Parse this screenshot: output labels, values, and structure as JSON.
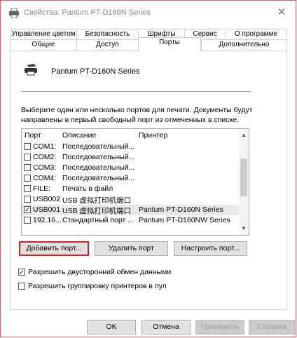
{
  "window": {
    "title": "Свойства: Pantum PT-D160N Series",
    "close_glyph": "✕"
  },
  "tabs_row1": [
    "Управление цветом",
    "Безопасность",
    "Шрифты",
    "Сервис",
    "О программе"
  ],
  "tabs_row2": [
    "Общие",
    "Доступ",
    "Порты",
    "Дополнительно"
  ],
  "active_tab": "Порты",
  "printer": {
    "name": "Pantum PT-D160N Series",
    "icon": "printer-icon"
  },
  "description": "Выберите один или несколько портов для печати. Документы будут направлены в первый свободный порт из отмеченных в списке.",
  "ports_table": {
    "headers": {
      "port": "Порт",
      "description": "Описание",
      "printer": "Принтер"
    },
    "rows": [
      {
        "port": "COM1:",
        "description": "Последовательный...",
        "printer": "",
        "checked": false
      },
      {
        "port": "COM2:",
        "description": "Последовательный...",
        "printer": "",
        "checked": false
      },
      {
        "port": "COM3:",
        "description": "Последовательный...",
        "printer": "",
        "checked": false
      },
      {
        "port": "COM4:",
        "description": "Последовательный...",
        "printer": "",
        "checked": false
      },
      {
        "port": "FILE:",
        "description": "Печать в файл",
        "printer": "",
        "checked": false
      },
      {
        "port": "USB002",
        "description": "USB 虚拟打印机端口",
        "printer": "",
        "checked": false
      },
      {
        "port": "USB001",
        "description": "USB 虚拟打印机端口",
        "printer": "Pantum PT-D160N Series",
        "checked": true
      },
      {
        "port": "192.16...",
        "description": "Стандартный порт ...",
        "printer": "Pantum PT-D160NW Series",
        "checked": false
      }
    ]
  },
  "buttons": {
    "add_port": "Добавить порт...",
    "delete_port": "Удалить порт",
    "configure_port": "Настроить порт..."
  },
  "options": {
    "bidirectional": {
      "label": "Разрешить двусторонний обмен данными",
      "checked": true
    },
    "pooling": {
      "label": "Разрешить группировку принтеров в пул",
      "checked": false
    }
  },
  "dialog_buttons": {
    "ok": "OK",
    "cancel": "Отмена",
    "apply": "Применить",
    "help": "Справка"
  },
  "colors": {
    "highlight_border": "#d42020",
    "button_face": "#e1e1e1",
    "disabled_text": "#a0a0a0"
  }
}
